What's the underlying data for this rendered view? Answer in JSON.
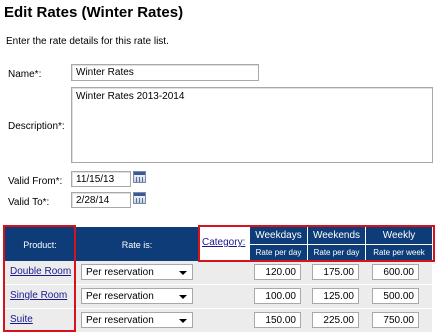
{
  "page": {
    "title": "Edit Rates (Winter Rates)",
    "intro": "Enter the rate details for this rate list."
  },
  "form": {
    "name_label": "Name*:",
    "name_value": "Winter Rates",
    "description_label": "Description*:",
    "description_value": "Winter Rates 2013-2014",
    "valid_from_label": "Valid From*:",
    "valid_from_value": "11/15/13",
    "valid_to_label": "Valid To*:",
    "valid_to_value": "2/28/14"
  },
  "table": {
    "headers": {
      "product": "Product:",
      "rate_is": "Rate is:",
      "category": "Category:",
      "weekdays": "Weekdays",
      "weekends": "Weekends",
      "weekly": "Weekly",
      "rate_per_day_1": "Rate per day",
      "rate_per_day_2": "Rate per day",
      "rate_per_week": "Rate per week"
    },
    "rows": [
      {
        "product": "Double Room",
        "rate_is": "Per reservation",
        "weekdays": "120.00",
        "weekends": "175.00",
        "weekly": "600.00"
      },
      {
        "product": "Single Room",
        "rate_is": "Per reservation",
        "weekdays": "100.00",
        "weekends": "125.00",
        "weekly": "500.00"
      },
      {
        "product": "Suite",
        "rate_is": "Per reservation",
        "weekdays": "150.00",
        "weekends": "225.00",
        "weekly": "750.00"
      }
    ]
  },
  "colors": {
    "header_bg": "#0d3c78",
    "highlight_border": "#d4131c",
    "row_bg": "#ececec",
    "link": "#1a1a8c"
  },
  "icons": [
    "calendar-icon",
    "chevron-down-icon"
  ]
}
